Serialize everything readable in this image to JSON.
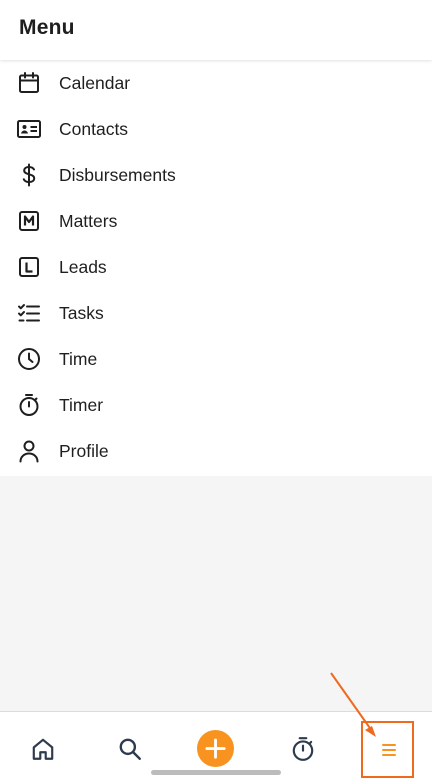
{
  "header": {
    "title": "Menu"
  },
  "menu": {
    "items": [
      {
        "label": "Calendar",
        "icon": "calendar-icon"
      },
      {
        "label": "Contacts",
        "icon": "contact-card-icon"
      },
      {
        "label": "Disbursements",
        "icon": "dollar-icon"
      },
      {
        "label": "Matters",
        "icon": "matters-m-icon"
      },
      {
        "label": "Leads",
        "icon": "leads-l-icon"
      },
      {
        "label": "Tasks",
        "icon": "checklist-icon"
      },
      {
        "label": "Time",
        "icon": "clock-icon"
      },
      {
        "label": "Timer",
        "icon": "stopwatch-icon"
      },
      {
        "label": "Profile",
        "icon": "person-icon"
      }
    ]
  },
  "tabbar": {
    "tabs": [
      {
        "icon": "home-icon"
      },
      {
        "icon": "search-icon"
      },
      {
        "icon": "add-icon"
      },
      {
        "icon": "stopwatch-icon"
      },
      {
        "icon": "hamburger-menu-icon",
        "selected": true
      }
    ]
  },
  "colors": {
    "accent": "#f7931e",
    "annotation": "#ee6a1f",
    "text": "#1f1f1f",
    "background": "#f5f5f5"
  }
}
